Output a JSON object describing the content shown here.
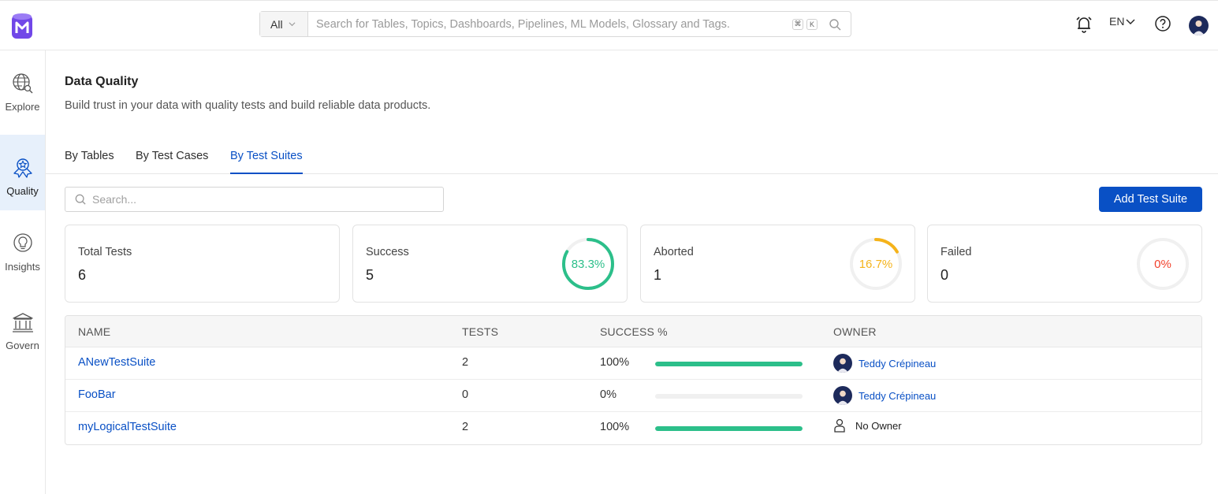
{
  "header": {
    "search_scope": "All",
    "search_placeholder": "Search for Tables, Topics, Dashboards, Pipelines, ML Models, Glossary and Tags.",
    "kbd_cmd": "⌘",
    "kbd_k": "K",
    "language": "EN"
  },
  "nav": {
    "items": [
      {
        "label": "Explore",
        "icon": "explore-icon"
      },
      {
        "label": "Quality",
        "icon": "quality-icon"
      },
      {
        "label": "Insights",
        "icon": "insights-icon"
      },
      {
        "label": "Govern",
        "icon": "govern-icon"
      }
    ],
    "active": "Quality"
  },
  "page": {
    "title": "Data Quality",
    "subtitle": "Build trust in your data with quality tests and build reliable data products."
  },
  "tabs": [
    {
      "label": "By Tables"
    },
    {
      "label": "By Test Cases"
    },
    {
      "label": "By Test Suites"
    }
  ],
  "active_tab": "By Test Suites",
  "toolbar": {
    "search_placeholder": "Search...",
    "add_label": "Add Test Suite"
  },
  "summary": {
    "total": {
      "label": "Total Tests",
      "value": "6"
    },
    "success": {
      "label": "Success",
      "value": "5",
      "percent_text": "83.3%",
      "percent": 83.3,
      "color": "#2cbf8a"
    },
    "aborted": {
      "label": "Aborted",
      "value": "1",
      "percent_text": "16.7%",
      "percent": 16.7,
      "color": "#f5b31a"
    },
    "failed": {
      "label": "Failed",
      "value": "0",
      "percent_text": "0%",
      "percent": 0,
      "color": "#f2422d"
    }
  },
  "table": {
    "headers": {
      "name": "NAME",
      "tests": "TESTS",
      "success": "SUCCESS %",
      "owner": "OWNER"
    },
    "rows": [
      {
        "name": "ANewTestSuite",
        "tests": "2",
        "success_text": "100%",
        "success": 100,
        "owner": "Teddy Crépineau"
      },
      {
        "name": "FooBar",
        "tests": "0",
        "success_text": "0%",
        "success": 0,
        "owner": "Teddy Crépineau"
      },
      {
        "name": "myLogicalTestSuite",
        "tests": "2",
        "success_text": "100%",
        "success": 100,
        "owner": "No Owner"
      }
    ]
  },
  "colors": {
    "accent": "#0950c5",
    "success": "#2cbf8a",
    "aborted": "#f5b31a",
    "failed": "#f2422d"
  }
}
